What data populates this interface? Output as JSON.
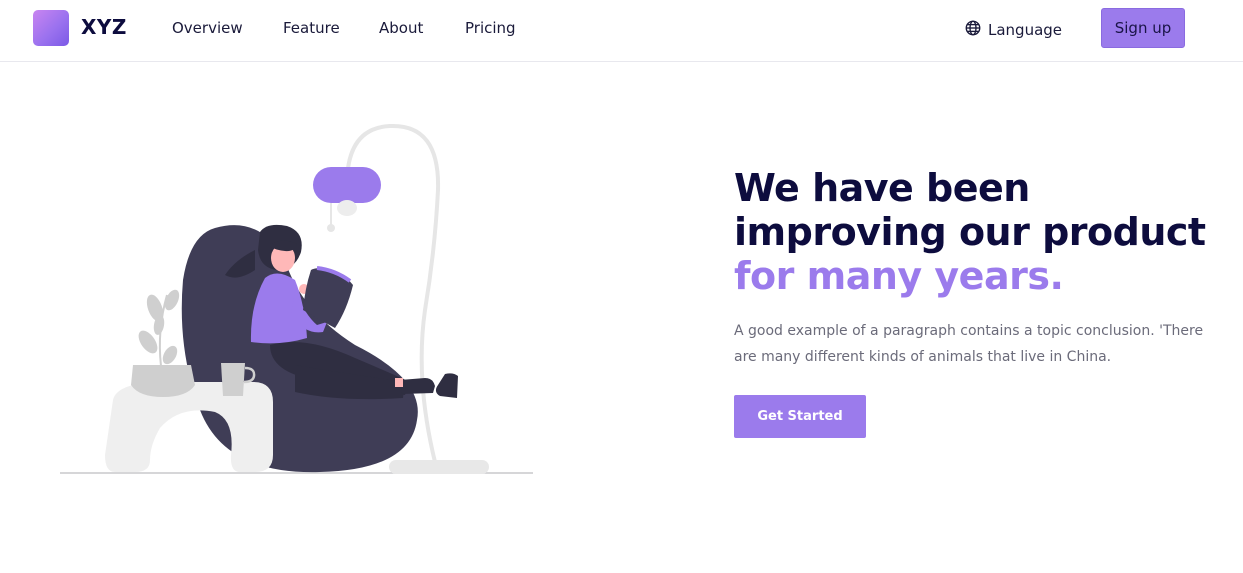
{
  "brand": {
    "name": "XYZ"
  },
  "nav": {
    "items": [
      {
        "label": "Overview"
      },
      {
        "label": "Feature"
      },
      {
        "label": "About"
      },
      {
        "label": "Pricing"
      }
    ]
  },
  "header": {
    "language_label": "Language",
    "language_icon": "globe-icon",
    "signup_label": "Sign up"
  },
  "hero": {
    "title_line1": "We have been",
    "title_line2": "improving our product",
    "title_accent": "for many years.",
    "description": "A good example of a paragraph contains a topic conclusion. 'There are many different kinds of animals that live in China.",
    "cta_label": "Get Started"
  },
  "colors": {
    "accent": "#9b7bec",
    "heading": "#0d0c3e",
    "body_text": "#6b6b7a"
  }
}
